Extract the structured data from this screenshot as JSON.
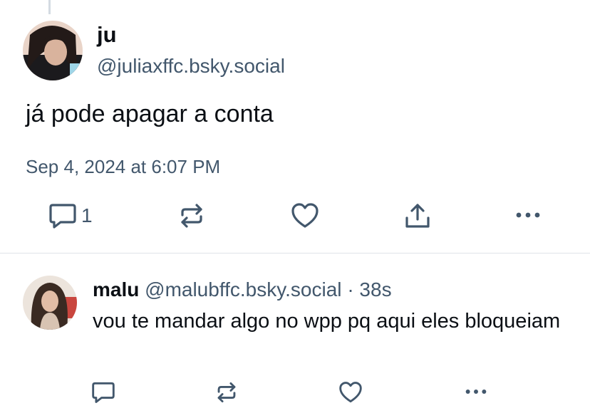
{
  "post": {
    "author_name": "ju",
    "author_handle": "@juliaxffc.bsky.social",
    "text": "já pode apagar a conta",
    "timestamp": "Sep 4, 2024 at 6:07 PM",
    "reply_count": "1",
    "icons": [
      "reply-icon",
      "repost-icon",
      "like-icon",
      "share-icon",
      "more-icon"
    ]
  },
  "reply": {
    "author_name": "malu",
    "author_handle": "@malubffc.bsky.social",
    "separator": "·",
    "age": "38s",
    "text": "vou te mandar algo no wpp pq aqui eles bloqueiam",
    "icons": [
      "reply-icon",
      "repost-icon",
      "like-icon",
      "more-icon"
    ]
  },
  "colors": {
    "text_primary": "#0b0f14",
    "text_secondary": "#42576c",
    "divider": "#dfe4e9",
    "background": "#ffffff"
  }
}
